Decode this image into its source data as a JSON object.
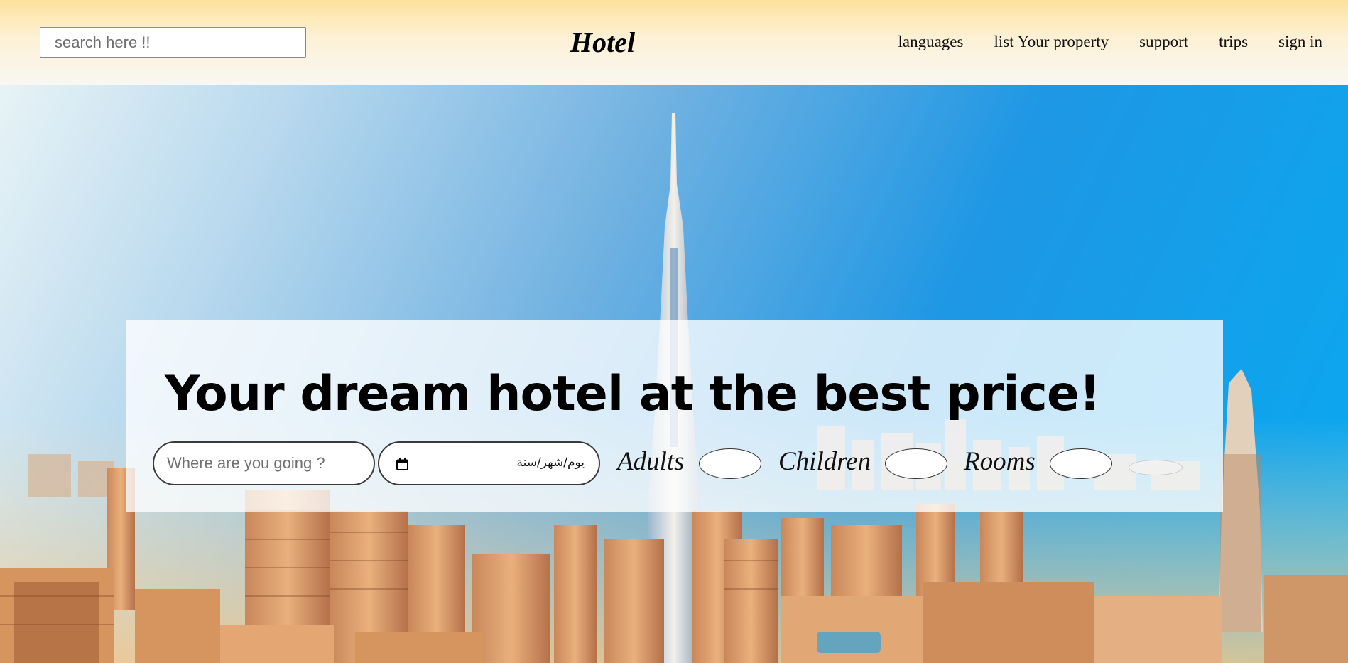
{
  "header": {
    "search_placeholder": "search here !!",
    "brand": "Hotel",
    "nav": [
      "languages",
      "list Your property",
      "support",
      "trips",
      "sign in"
    ]
  },
  "hero": {
    "headline": "Your dream hotel at the best price!",
    "destination_placeholder": "Where are you going ?",
    "date_value": "يوم/شهر/سنة",
    "counters": {
      "adults_label": "Adults",
      "children_label": "Children",
      "rooms_label": "Rooms"
    }
  },
  "icons": [
    "calendar-icon"
  ],
  "colors": {
    "header_top": "#fde19c",
    "header_bottom": "#f9f7f2",
    "sky_left": "#e7f3f6",
    "sky_right": "#08aaf1",
    "panel": "#ffffff"
  }
}
